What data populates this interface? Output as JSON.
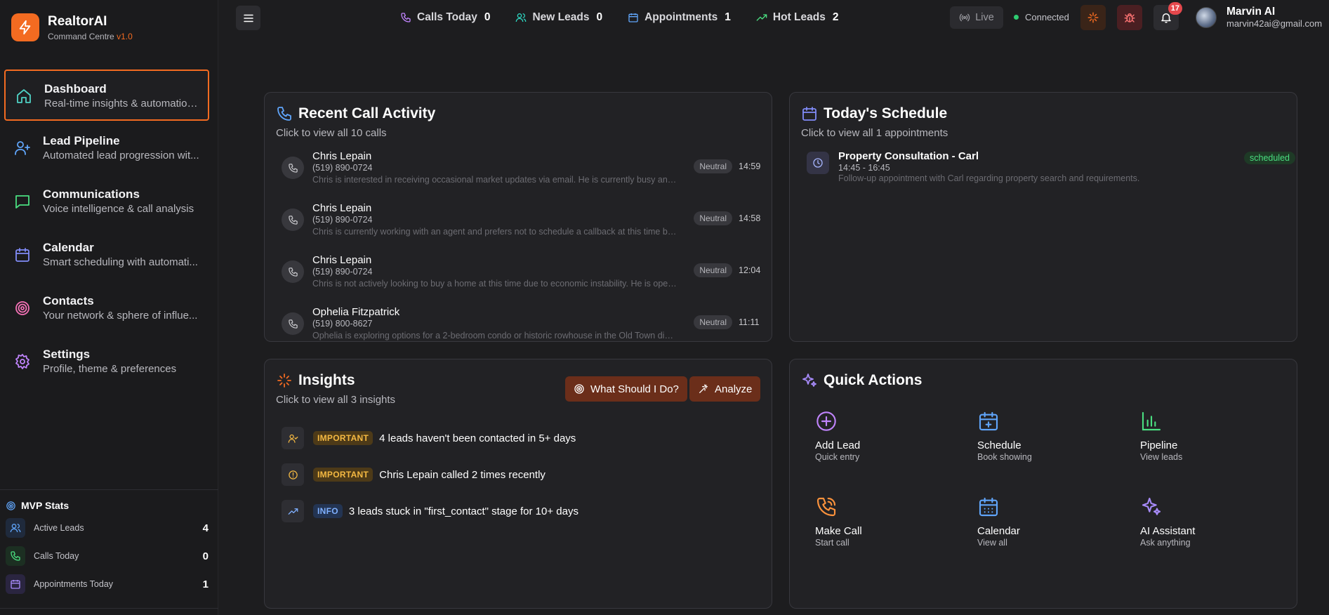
{
  "brand": {
    "name": "RealtorAI",
    "subtitle": "Command Centre",
    "version": "v1.0"
  },
  "nav": [
    {
      "label": "Dashboard",
      "desc": "Real-time insights & automation ...",
      "icon": "home-icon",
      "color": "#4fd1c5"
    },
    {
      "label": "Lead Pipeline",
      "desc": "Automated lead progression wit...",
      "icon": "user-plus-icon",
      "color": "#60a5fa"
    },
    {
      "label": "Communications",
      "desc": "Voice intelligence & call analysis",
      "icon": "message-icon",
      "color": "#4ade80"
    },
    {
      "label": "Calendar",
      "desc": "Smart scheduling with automati...",
      "icon": "calendar-icon",
      "color": "#818cf8"
    },
    {
      "label": "Contacts",
      "desc": "Your network & sphere of influe...",
      "icon": "target-icon",
      "color": "#f472b6"
    },
    {
      "label": "Settings",
      "desc": "Profile, theme & preferences",
      "icon": "gear-icon",
      "color": "#c084fc"
    }
  ],
  "mvp_stats": {
    "title": "MVP Stats",
    "rows": [
      {
        "label": "Active Leads",
        "value": "4",
        "icon": "users-icon",
        "color": "#60a5fa"
      },
      {
        "label": "Calls Today",
        "value": "0",
        "icon": "phone-icon",
        "color": "#4ade80"
      },
      {
        "label": "Appointments Today",
        "value": "1",
        "icon": "calendar-icon",
        "color": "#a78bfa"
      }
    ]
  },
  "topbar": {
    "stats": [
      {
        "label": "Calls Today",
        "value": "0",
        "icon": "phone-icon",
        "color": "#c084fc"
      },
      {
        "label": "New Leads",
        "value": "0",
        "icon": "users-icon",
        "color": "#2dd4bf"
      },
      {
        "label": "Appointments",
        "value": "1",
        "icon": "calendar-icon",
        "color": "#60a5fa"
      },
      {
        "label": "Hot Leads",
        "value": "2",
        "icon": "trending-up-icon",
        "color": "#4ade80"
      }
    ],
    "live_label": "Live",
    "connection_status": "Connected",
    "notification_count": "17",
    "user": {
      "name": "Marvin AI",
      "email": "marvin42ai@gmail.com"
    }
  },
  "recent_calls": {
    "title": "Recent Call Activity",
    "subtitle": "Click to view all 10 calls",
    "items": [
      {
        "name": "Chris Lepain",
        "phone": "(519) 890-0724",
        "summary": "Chris is interested in receiving occasional market updates via email. He is currently busy and prefers not to be called right now.",
        "sentiment": "Neutral",
        "time": "14:59"
      },
      {
        "name": "Chris Lepain",
        "phone": "(519) 890-0724",
        "summary": "Chris is currently working with an agent and prefers not to schedule a callback at this time but may reach out later.",
        "sentiment": "Neutral",
        "time": "14:58"
      },
      {
        "name": "Chris Lepain",
        "phone": "(519) 890-0724",
        "summary": "Chris is not actively looking to buy a home at this time due to economic instability. He is open to future contact.",
        "sentiment": "Neutral",
        "time": "12:04"
      },
      {
        "name": "Ophelia Fitzpatrick",
        "phone": "(519) 800-8627",
        "summary": "Ophelia is exploring options for a 2-bedroom condo or historic rowhouse in the Old Town district.",
        "sentiment": "Neutral",
        "time": "11:11"
      }
    ]
  },
  "schedule": {
    "title": "Today's Schedule",
    "subtitle": "Click to view all 1 appointments",
    "items": [
      {
        "title": "Property Consultation - Carl",
        "time": "14:45 - 16:45",
        "desc": "Follow-up appointment with Carl regarding property search and requirements.",
        "status": "scheduled"
      }
    ]
  },
  "insights": {
    "title": "Insights",
    "subtitle": "Click to view all 3 insights",
    "btn_what": "What Should I Do?",
    "btn_analyze": "Analyze",
    "items": [
      {
        "tag": "IMPORTANT",
        "text": "4 leads haven't been contacted in 5+ days",
        "icon": "user-check-icon"
      },
      {
        "tag": "IMPORTANT",
        "text": "Chris Lepain called 2 times recently",
        "icon": "alert-circle-icon"
      },
      {
        "tag": "INFO",
        "text": "3 leads stuck in \"first_contact\" stage for 10+ days",
        "icon": "trending-up-icon"
      }
    ]
  },
  "quick_actions": {
    "title": "Quick Actions",
    "items": [
      {
        "label": "Add Lead",
        "sub": "Quick entry",
        "icon": "plus-circle-icon",
        "color": "#c084fc"
      },
      {
        "label": "Schedule",
        "sub": "Book showing",
        "icon": "calendar-plus-icon",
        "color": "#60a5fa"
      },
      {
        "label": "Pipeline",
        "sub": "View leads",
        "icon": "bar-chart-icon",
        "color": "#4ade80"
      },
      {
        "label": "Make Call",
        "sub": "Start call",
        "icon": "phone-call-icon",
        "color": "#fb923c"
      },
      {
        "label": "Calendar",
        "sub": "View all",
        "icon": "calendar-icon",
        "color": "#60a5fa"
      },
      {
        "label": "AI Assistant",
        "sub": "Ask anything",
        "icon": "sparkles-icon",
        "color": "#a78bfa"
      }
    ]
  },
  "colors": {
    "accent": "#f36b21",
    "bg": "#1d1d1f",
    "card": "#222225"
  }
}
